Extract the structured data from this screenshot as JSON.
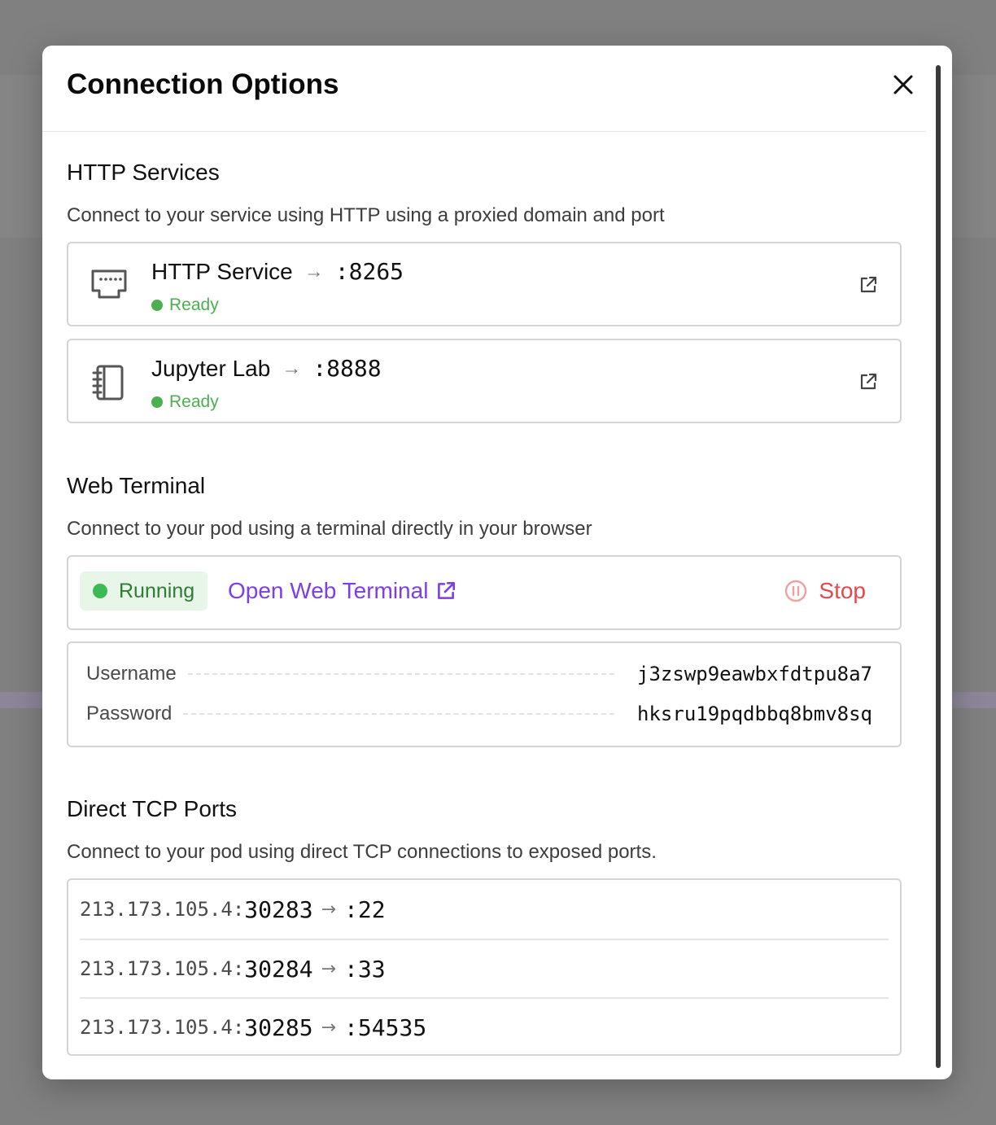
{
  "modal": {
    "title": "Connection Options"
  },
  "http": {
    "title": "HTTP Services",
    "description": "Connect to your service using HTTP using a proxied domain and port",
    "services": [
      {
        "name": "HTTP Service",
        "port": ":8265",
        "status": "Ready",
        "icon": "ethernet-port-icon"
      },
      {
        "name": "Jupyter Lab",
        "port": ":8888",
        "status": "Ready",
        "icon": "notebook-icon"
      }
    ]
  },
  "terminal": {
    "title": "Web Terminal",
    "description": "Connect to your pod using a terminal directly in your browser",
    "status": "Running",
    "open_label": "Open Web Terminal",
    "stop_label": "Stop",
    "username_label": "Username",
    "username": "j3zswp9eawbxfdtpu8a7",
    "password_label": "Password",
    "password": "hksru19pqdbbq8bmv8sq"
  },
  "tcp": {
    "title": "Direct TCP Ports",
    "description": "Connect to your pod using direct TCP connections to exposed ports.",
    "ports": [
      {
        "ip": "213.173.105.4:",
        "public_port": "30283",
        "target": ":22"
      },
      {
        "ip": "213.173.105.4:",
        "public_port": "30284",
        "target": ":33"
      },
      {
        "ip": "213.173.105.4:",
        "public_port": "30285",
        "target": ":54535"
      }
    ]
  },
  "colors": {
    "ready": "#4caf50",
    "link": "#7b3fe4",
    "stop": "#e5484d"
  }
}
